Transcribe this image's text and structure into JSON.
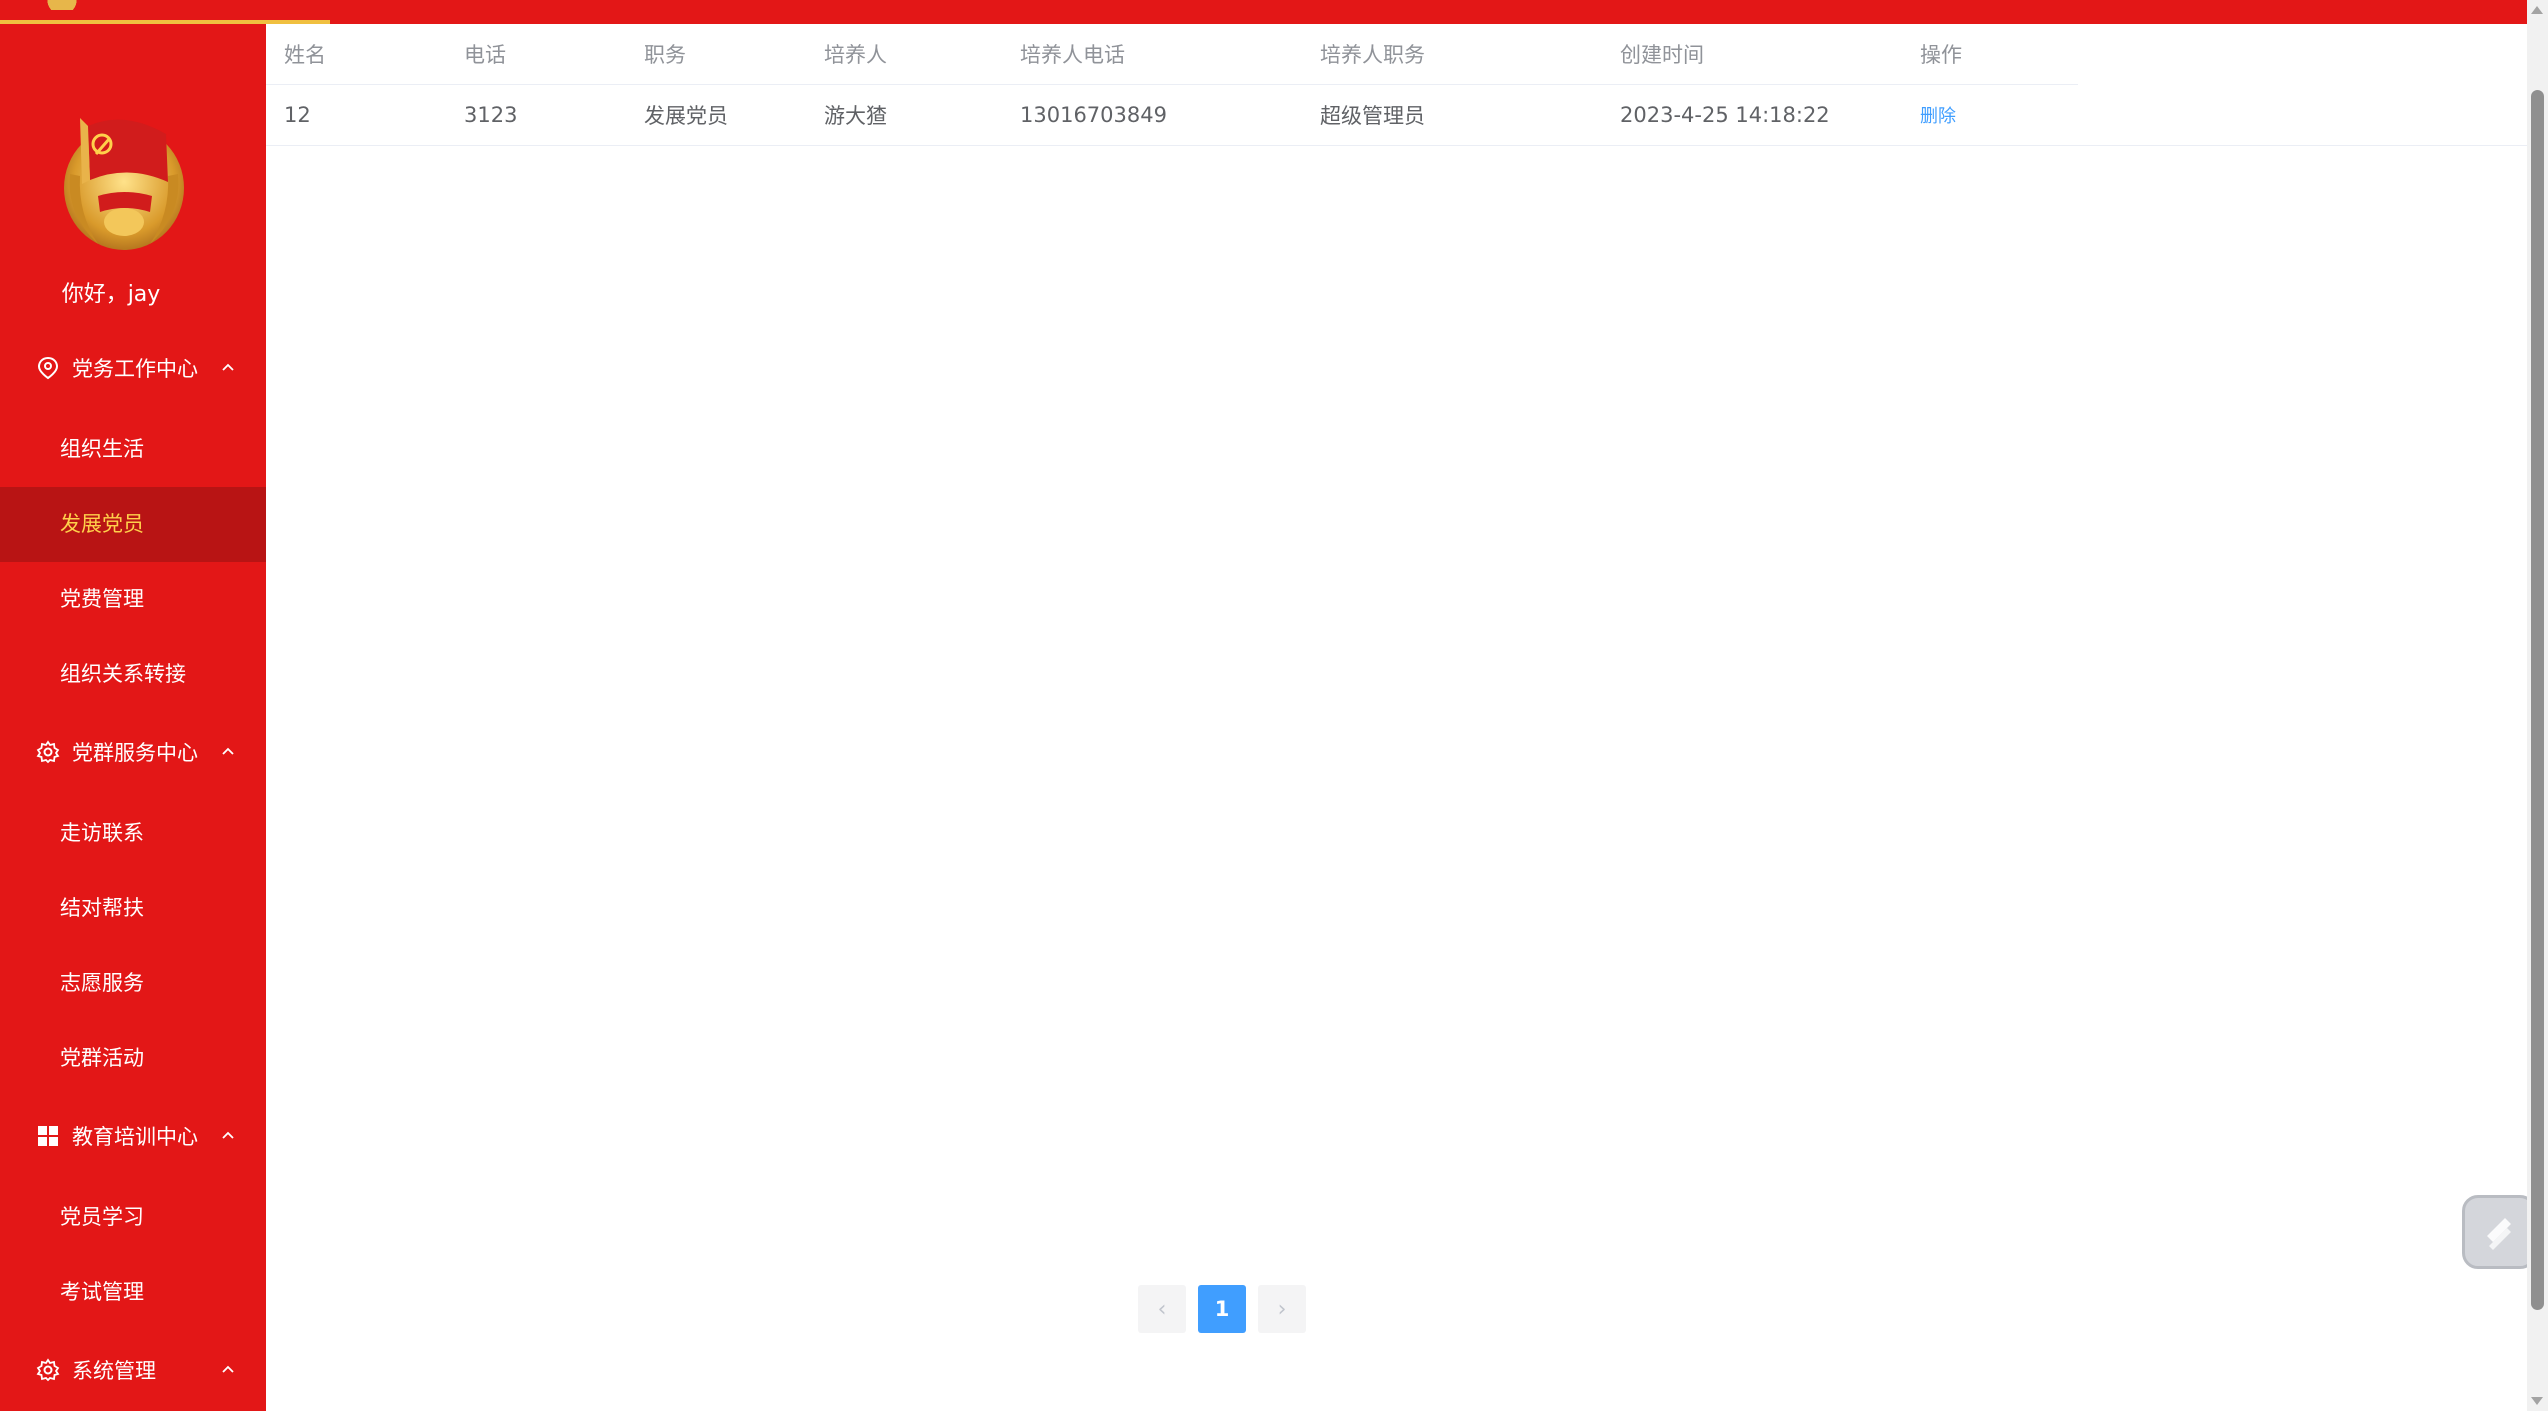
{
  "user": {
    "greeting": "你好，jay"
  },
  "sidebar": {
    "groups": [
      {
        "title": "党务工作中心",
        "icon": "location-pin-icon",
        "items": [
          {
            "label": "组织生活"
          },
          {
            "label": "发展党员",
            "active": true
          },
          {
            "label": "党费管理"
          },
          {
            "label": "组织关系转接"
          }
        ]
      },
      {
        "title": "党群服务中心",
        "icon": "gear-icon",
        "items": [
          {
            "label": "走访联系"
          },
          {
            "label": "结对帮扶"
          },
          {
            "label": "志愿服务"
          },
          {
            "label": "党群活动"
          }
        ]
      },
      {
        "title": "教育培训中心",
        "icon": "grid-icon",
        "items": [
          {
            "label": "党员学习"
          },
          {
            "label": "考试管理"
          }
        ]
      },
      {
        "title": "系统管理",
        "icon": "gear-icon",
        "items": []
      }
    ]
  },
  "table": {
    "headers": [
      "姓名",
      "电话",
      "职务",
      "培养人",
      "培养人电话",
      "培养人职务",
      "创建时间",
      "操作"
    ],
    "rows": [
      {
        "name": "12",
        "phone": "3123",
        "position": "发展党员",
        "trainer": "游大猹",
        "trainer_phone": "13016703849",
        "trainer_position": "超级管理员",
        "created": "2023-4-25 14:18:22",
        "action": "删除"
      }
    ]
  },
  "pagination": {
    "prev": "‹",
    "current": "1",
    "next": "›"
  },
  "colors": {
    "primary_red": "#e31717",
    "active_bg": "#b81414",
    "active_text": "#ffd04b",
    "link_blue": "#409eff"
  }
}
